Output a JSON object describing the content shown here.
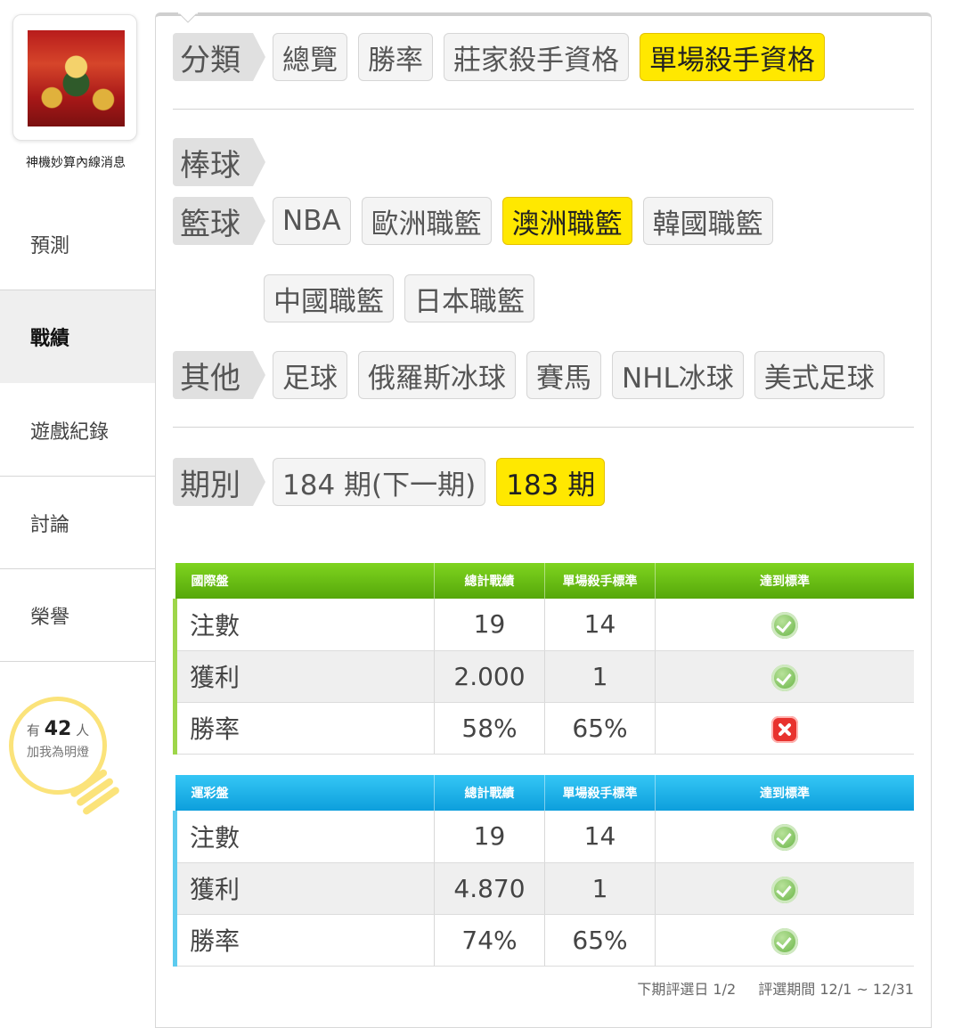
{
  "sidebar": {
    "user_name": "神機妙算內線消息",
    "nav": [
      "預測",
      "戰績",
      "遊戲紀錄",
      "討論",
      "榮譽"
    ],
    "active_nav": "戰績",
    "bulb": {
      "prefix": "有",
      "count": "42",
      "suffix": "人",
      "line2": "加我為明燈"
    }
  },
  "filters": {
    "category": {
      "label": "分類",
      "items": [
        "總覽",
        "勝率",
        "莊家殺手資格",
        "單場殺手資格"
      ],
      "active": "單場殺手資格"
    },
    "baseball": {
      "label": "棒球"
    },
    "basketball": {
      "label": "籃球",
      "items": [
        "NBA",
        "歐洲職籃",
        "澳洲職籃",
        "韓國職籃",
        "中國職籃",
        "日本職籃"
      ],
      "active": "澳洲職籃"
    },
    "other": {
      "label": "其他",
      "items": [
        "足球",
        "俄羅斯冰球",
        "賽馬",
        "NHL冰球",
        "美式足球"
      ]
    },
    "period": {
      "label": "期別",
      "items": [
        "184 期(下一期)",
        "183 期"
      ],
      "active": "183 期"
    }
  },
  "tables": {
    "intl": {
      "headers": [
        "國際盤",
        "總計戰績",
        "單場殺手標準",
        "達到標準"
      ],
      "rows": [
        {
          "name": "注數",
          "total": "19",
          "standard": "14",
          "met": true
        },
        {
          "name": "獲利",
          "total": "2.000",
          "standard": "1",
          "met": true
        },
        {
          "name": "勝率",
          "total": "58%",
          "standard": "65%",
          "met": false
        }
      ]
    },
    "lottery": {
      "headers": [
        "運彩盤",
        "總計戰績",
        "單場殺手標準",
        "達到標準"
      ],
      "rows": [
        {
          "name": "注數",
          "total": "19",
          "standard": "14",
          "met": true
        },
        {
          "name": "獲利",
          "total": "4.870",
          "standard": "1",
          "met": true
        },
        {
          "name": "勝率",
          "total": "74%",
          "standard": "65%",
          "met": true
        }
      ]
    }
  },
  "footer": {
    "next_date": "下期評選日 1/2",
    "period_range": "評選期間 12/1 ~ 12/31"
  },
  "colors": {
    "active_chip": "#ffe800",
    "intl_header": "#55a70a",
    "lottery_header": "#0d9fdc",
    "ok": "#5fae3c",
    "bad": "#e8322e"
  }
}
